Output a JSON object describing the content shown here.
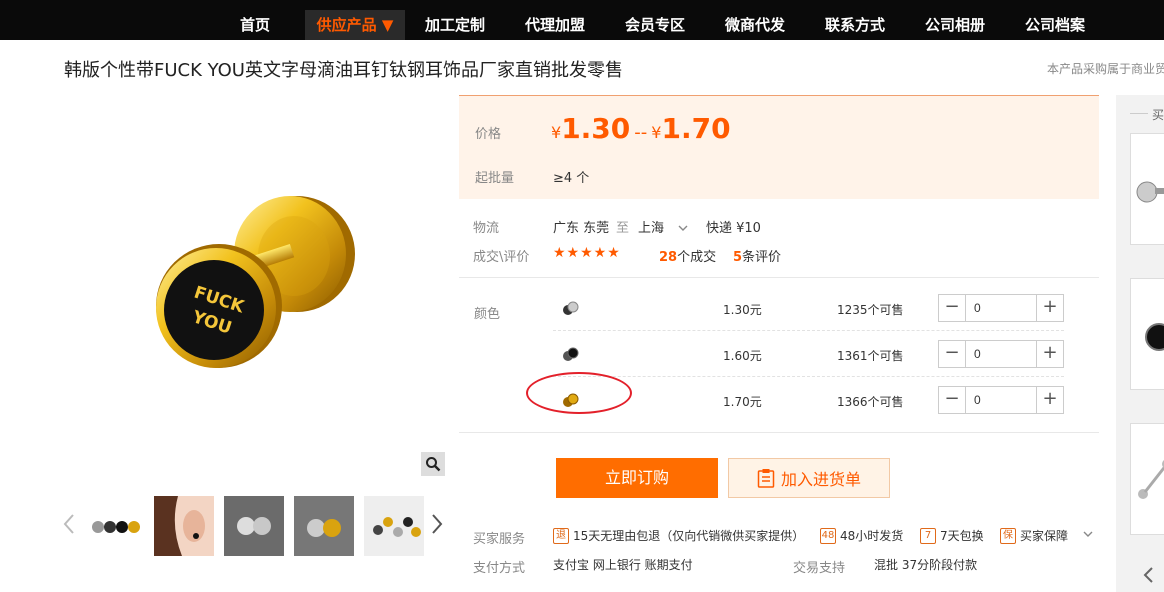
{
  "nav": {
    "items": [
      "首页",
      "供应产品 ▼",
      "加工定制",
      "代理加盟",
      "会员专区",
      "微商代发",
      "联系方式",
      "公司相册",
      "公司档案"
    ],
    "active_index": 1,
    "active_color": "#ff5a00"
  },
  "product": {
    "title": "韩版个性带FUCK YOU英文字母滴油耳钉钛钢耳饰品厂家直销批发零售",
    "notice": "本产品采购属于商业贸",
    "engraving": [
      "FUCK",
      "YOU"
    ]
  },
  "price": {
    "label": "价格",
    "yen": "¥",
    "low": "1.30",
    "dash": "--",
    "high": "1.70",
    "moq_label": "起批量",
    "moq_value": "≥4 个"
  },
  "logistics": {
    "label": "物流",
    "from": "广东 东莞",
    "to_word": "至",
    "to": "上海",
    "express": "快递 ¥10"
  },
  "reviews": {
    "label": "成交\\评价",
    "stars": "★★★★★",
    "deals_num": "28",
    "deals_text": "个成交",
    "reviews_num": "5",
    "reviews_text": "条评价"
  },
  "variants": {
    "label": "颜色",
    "rows": [
      {
        "price": "1.30元",
        "stock": "1235个可售",
        "qty": "0",
        "swatch": "silver"
      },
      {
        "price": "1.60元",
        "stock": "1361个可售",
        "qty": "0",
        "swatch": "black"
      },
      {
        "price": "1.70元",
        "stock": "1366个可售",
        "qty": "0",
        "swatch": "gold"
      }
    ]
  },
  "actions": {
    "buy": "立即订购",
    "cart": "加入进货单"
  },
  "services": {
    "label": "买家服务",
    "items": [
      {
        "icon": "退",
        "text": "15天无理由包退（仅向代销微供买家提供）"
      },
      {
        "icon": "48",
        "text": "48小时发货"
      },
      {
        "icon": "7",
        "text": "7天包换"
      },
      {
        "icon": "保",
        "text": "买家保障"
      }
    ]
  },
  "payment": {
    "label": "支付方式",
    "methods": "支付宝   网上银行   账期支付",
    "trade_label": "交易支持",
    "trade_values": "混批   37分阶段付款"
  },
  "sidebar": {
    "heading": "买"
  }
}
